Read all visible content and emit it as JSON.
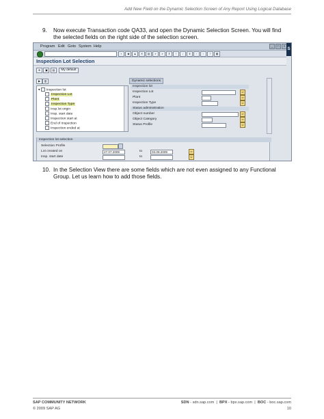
{
  "header": {
    "title": "Add New Field on the Dynamic Selection Screen of Any Report Using Logical Database"
  },
  "steps": [
    {
      "number": "9.",
      "text": "Now execute Transaction code QA33, and open the Dynamic Selection Screen. You will find the selected fields on the right side of the selection screen."
    },
    {
      "number": "10.",
      "text": "In the Selection View there are some fields which are not even assigned to any Functional Group. Let us learn how to add those fields."
    }
  ],
  "sap_window": {
    "menu": [
      "Program",
      "Edit",
      "Goto",
      "System",
      "Help"
    ],
    "screen_title": "Inspection Lot Selection",
    "app_toolbar": {
      "my_default_label": "My default"
    },
    "tree": {
      "root": "Inspection lot",
      "items": [
        "Inspection Lot",
        "Plant",
        "Inspection Type",
        "Insp.lot origin",
        "Insp. start date",
        "Inspection start at",
        "End of Inspection",
        "Inspection ended at"
      ]
    },
    "dynamic_selections": {
      "tab_label": "Dynamic selections",
      "group1": "Inspection lot",
      "fields1": [
        "Inspection Lot",
        "Plant",
        "Inspection Type"
      ],
      "group2": "Status administration",
      "fields2": [
        "Object number",
        "Object Category",
        "Status Profile"
      ]
    },
    "selection_frame": {
      "caption": "Inspection lot selection",
      "selection_profile_label": "Selection Profile",
      "lot_created_on_label": "Lot created on",
      "lot_created_from": "27.07.2009",
      "to_label": "to",
      "lot_created_to": "03.08.2009",
      "insp_start_date_label": "Insp. start date"
    }
  },
  "footer": {
    "network": "SAP COMMUNITY NETWORK",
    "sdn_label": "SDN",
    "sdn_url": "sdn.sap.com",
    "bpx_label": "BPX",
    "bpx_url": "bpx.sap.com",
    "boc_label": "BOC",
    "boc_url": "boc.sap.com",
    "copyright": "© 2009 SAP AG",
    "page_number": "10"
  }
}
